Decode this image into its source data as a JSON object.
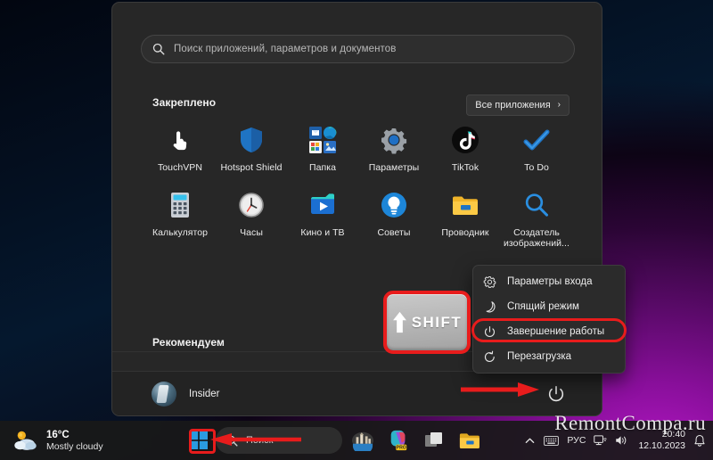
{
  "start_menu": {
    "search": {
      "placeholder": "Поиск приложений, параметров и документов",
      "icon": "search-icon"
    },
    "pinned_label": "Закреплено",
    "all_apps_button": {
      "label": "Все приложения",
      "chevron": "›"
    },
    "apps": [
      {
        "label": "TouchVPN",
        "icon": "hand-cursor-icon"
      },
      {
        "label": "Hotspot Shield",
        "icon": "shield-icon"
      },
      {
        "label": "Папка",
        "icon": "folder-group-icon"
      },
      {
        "label": "Параметры",
        "icon": "gear-icon"
      },
      {
        "label": "TikTok",
        "icon": "tiktok-icon"
      },
      {
        "label": "To Do",
        "icon": "checkmark-icon"
      },
      {
        "label": "Калькулятор",
        "icon": "calculator-icon"
      },
      {
        "label": "Часы",
        "icon": "clock-icon"
      },
      {
        "label": "Кино и ТВ",
        "icon": "movies-tv-icon"
      },
      {
        "label": "Советы",
        "icon": "lightbulb-icon"
      },
      {
        "label": "Проводник",
        "icon": "folder-icon"
      },
      {
        "label": "Создатель изображений...",
        "icon": "magnifier-icon"
      }
    ],
    "recommended_label": "Рекомендуем",
    "user": {
      "name": "Insider",
      "avatar": "user-avatar"
    },
    "power_button_icon": "power-icon"
  },
  "power_menu": {
    "items": [
      {
        "label": "Параметры входа",
        "icon": "gear-icon",
        "highlighted": false
      },
      {
        "label": "Спящий режим",
        "icon": "moon-icon",
        "highlighted": false
      },
      {
        "label": "Завершение работы",
        "icon": "power-icon",
        "highlighted": true
      },
      {
        "label": "Перезагрузка",
        "icon": "restart-icon",
        "highlighted": false
      }
    ]
  },
  "annotations": {
    "shift_key_label": "SHIFT",
    "shift_key_arrow": "up-arrow-icon",
    "highlight_color": "#e81c1c"
  },
  "taskbar": {
    "weather": {
      "temperature": "16°C",
      "condition": "Mostly cloudy",
      "icon": "sun-cloud-icon"
    },
    "start_button_icon": "windows-logo-icon",
    "search": {
      "label": "Поиск",
      "icon": "search-icon"
    },
    "apps": [
      {
        "name": "widgets-city-icon"
      },
      {
        "name": "copilot-pro-icon"
      },
      {
        "name": "task-view-icon"
      },
      {
        "name": "file-explorer-icon"
      }
    ],
    "tray": {
      "overflow_icon": "chevron-up-icon",
      "keyboard_icon": "touch-keyboard-icon",
      "language": "РУС",
      "network_icon": "network-icon",
      "volume_icon": "speaker-icon",
      "time": "20:40",
      "date": "12.10.2023",
      "notification_icon": "bell-icon"
    }
  },
  "watermark": "RemontCompa.ru"
}
